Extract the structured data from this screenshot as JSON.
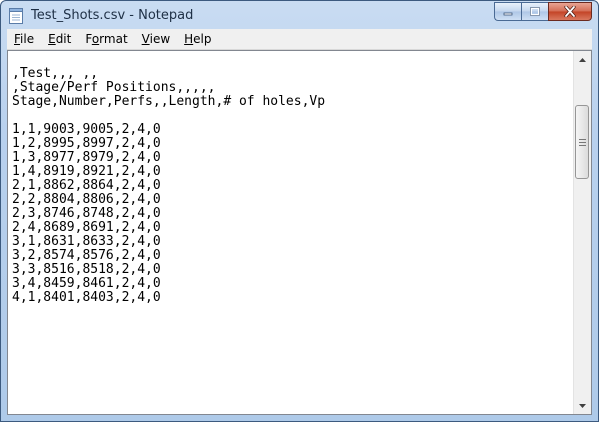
{
  "window": {
    "title": "Test_Shots.csv - Notepad"
  },
  "menu": [
    {
      "before": "",
      "mnemonic": "F",
      "after": "ile"
    },
    {
      "before": "",
      "mnemonic": "E",
      "after": "dit"
    },
    {
      "before": "F",
      "mnemonic": "o",
      "after": "rmat"
    },
    {
      "before": "",
      "mnemonic": "V",
      "after": "iew"
    },
    {
      "before": "",
      "mnemonic": "H",
      "after": "elp"
    }
  ],
  "document": {
    "lines": [
      ",Test,,, ,,",
      ",Stage/Perf Positions,,,,,",
      "Stage,Number,Perfs,,Length,# of holes,Vp",
      "",
      "1,1,9003,9005,2,4,0",
      "1,2,8995,8997,2,4,0",
      "1,3,8977,8979,2,4,0",
      "1,4,8919,8921,2,4,0",
      "2,1,8862,8864,2,4,0",
      "2,2,8804,8806,2,4,0",
      "2,3,8746,8748,2,4,0",
      "2,4,8689,8691,2,4,0",
      "3,1,8631,8633,2,4,0",
      "3,2,8574,8576,2,4,0",
      "3,3,8516,8518,2,4,0",
      "3,4,8459,8461,2,4,0",
      "4,1,8401,8403,2,4,0"
    ]
  }
}
